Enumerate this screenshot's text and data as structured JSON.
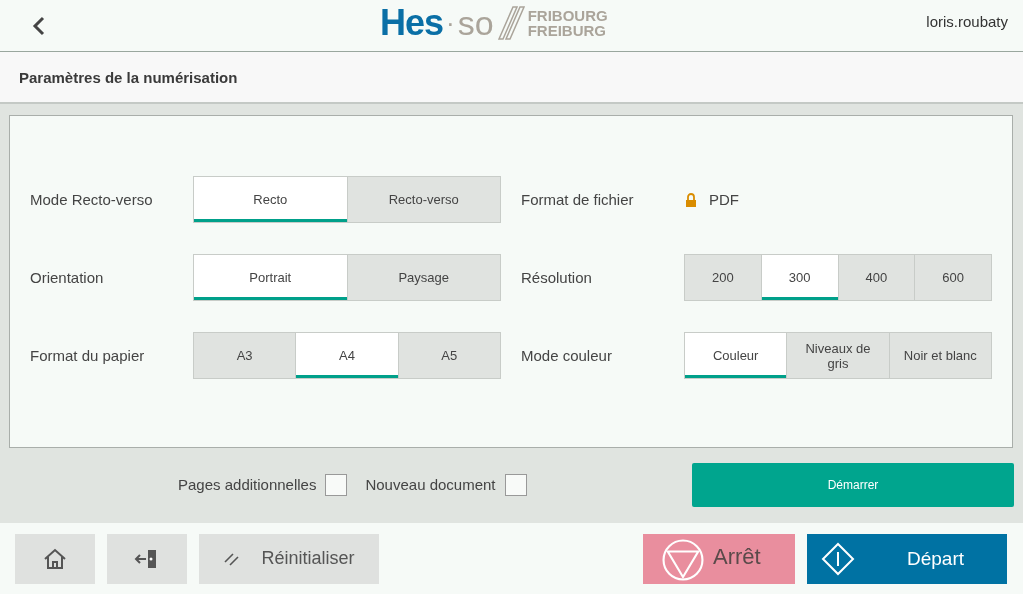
{
  "header": {
    "logo": {
      "main": "Hes",
      "dot": "·",
      "second": "so",
      "line_1": "FRIBOURG",
      "line_2": "FREIBURG"
    },
    "user": "loris.roubaty"
  },
  "title": "Paramètres de la numérisation",
  "settings": [
    {
      "label": "Mode Recto-verso",
      "kind": "segmented",
      "options": [
        {
          "label": "Recto",
          "selected": true
        },
        {
          "label": "Recto-verso",
          "selected": false
        }
      ]
    },
    {
      "label": "Format de fichier",
      "kind": "locked",
      "value": "PDF"
    },
    {
      "label": "Orientation",
      "kind": "segmented",
      "options": [
        {
          "label": "Portrait",
          "selected": true
        },
        {
          "label": "Paysage",
          "selected": false
        }
      ]
    },
    {
      "label": "Résolution",
      "kind": "segmented",
      "options": [
        {
          "label": "200",
          "selected": false
        },
        {
          "label": "300",
          "selected": true
        },
        {
          "label": "400",
          "selected": false
        },
        {
          "label": "600",
          "selected": false
        }
      ]
    },
    {
      "label": "Format du papier",
      "kind": "segmented",
      "options": [
        {
          "label": "A3",
          "selected": false
        },
        {
          "label": "A4",
          "selected": true
        },
        {
          "label": "A5",
          "selected": false
        }
      ]
    },
    {
      "label": "Mode couleur",
      "kind": "segmented",
      "options": [
        {
          "label": "Couleur",
          "selected": true
        },
        {
          "label": "Niveaux de gris",
          "selected": false
        },
        {
          "label": "Noir et blanc",
          "selected": false
        }
      ]
    }
  ],
  "checkboxes": [
    {
      "label": "Pages additionnelles",
      "checked": false
    },
    {
      "label": "Nouveau document",
      "checked": false
    }
  ],
  "start_button": "Démarrer",
  "footer": {
    "reset": "Réinitialiser",
    "stop": "Arrêt",
    "go": "Départ"
  }
}
